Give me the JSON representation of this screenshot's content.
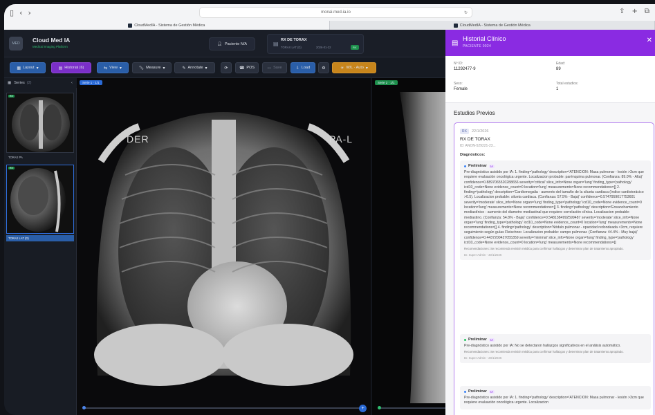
{
  "browser": {
    "url": "monai.med-ia.io",
    "tabs": [
      "CloudMedIA - Sistema de Gestión Médica",
      "CloudMedIA - Sistema de Gestión Médica"
    ]
  },
  "header": {
    "brand": "Cloud Med IA",
    "brand_sub": "Medical Imaging Platform",
    "patient_pill": "Paciente N/A",
    "study_title": "RX DE TORAX",
    "study_sub": "TORAX LAT (D)",
    "study_date": "2026-01-22",
    "study_badge": "RX"
  },
  "toolbar": {
    "layout": "Layout",
    "historial": "Historial (6)",
    "view": "View",
    "measure": "Measure",
    "annotate": "Annotate",
    "pos": "POS",
    "save": "Save",
    "load": "Load",
    "wl": "W/L · Auto"
  },
  "series": {
    "header": "Series",
    "count": "(2)",
    "items": [
      {
        "label": "TORAX PA",
        "badge": "RX"
      },
      {
        "label": "TORAX LAT (D)",
        "badge": "RX"
      }
    ]
  },
  "viewer": {
    "left_badge": "Serie 1 · 1/1",
    "right_badge": "Serie 2 · 1/1",
    "label_left": "DER",
    "label_right": "PA-L"
  },
  "panel": {
    "title": "Historial Clínico",
    "subtitle": "PACIENTE 0024",
    "id_label": "Nº ID:",
    "id_value": "11292477-9",
    "age_label": "Edad:",
    "age_value": "89",
    "sex_label": "Sexo:",
    "sex_value": "Female",
    "studies_label": "Total estudios:",
    "studies_value": "1",
    "previous_heading": "Estudios Previos",
    "card": {
      "badge": "RX",
      "date": "22/1/2026",
      "title": "RX DE TORAX",
      "id": "ID: ANON-529221-23...",
      "diag_label": "Diagnósticos:",
      "diagnoses": [
        {
          "status": "Preliminar",
          "tag": "IA",
          "text": "Pre-diagnóstico asistido por IA: 1. finding='pathology' description='ATENCION: Masa pulmonar - lesión >3cm que requiere evaluación oncológica urgente. Localizacion probable: parénquima pulmonar. (Confianza: 89.0% - Alta)' confidence=0.8897065520288656 severity='critical' slice_info=None organ='lung' finding_type='pathology' icd10_code=None evidence_count=0 location='lung' measurements=None recommendations=[] 2. finding='pathology' description='Cardiomegalia - aumento del tamaño de la silueta cardiaca (índice cardiotorácico >0.5). Localizacion probable: silueta cardiaca. (Confianza: 57.5% - Baja)' confidence=0.5747959017753601 severity='moderate' slice_info=None organ='lung' finding_type='pathology' icd10_code=None evidence_count=0 location='lung' measurements=None recommendations=[] 3. finding='pathology' description='Ensanchamiento mediastínico - aumento del diametro mediastinal que requiere correlación clínica. Localizacion probable: mediastino. (Confianza: 54.8% - Baja)' confidence=0.5481384992599487 severity='moderate' slice_info=None organ='lung' finding_type='pathology' icd10_code=None evidence_count=0 location='lung' measurements=None recommendations=[] 4. finding='pathology' description='Nódulo pulmonar - opacidad redondeada <3cm, requiere seguimiento según guías Fleischner. Localizacion probable: campo pulmonar. (Confianza: 44.4% - Muy baja)' confidence=0.4437200427055359 severity='minimal' slice_info=None organ='lung' finding_type='pathology' icd10_code=None evidence_count=0 location='lung' measurements=None recommendations=[]",
          "rec": "Recomendaciones: Se recomienda revisión médica para confirmar hallazgos y determinar plan de tratamiento apropiado.",
          "by": "Dr. Super Admin - 30/1/2026",
          "color": "#3b82f6"
        },
        {
          "status": "Preliminar",
          "tag": "IA",
          "text": "Pre-diagnóstico asistido por IA: No se detectaron hallazgos significativos en el análisis automático.",
          "rec": "Recomendaciones: Se recomienda revisión médica para confirmar hallazgos y determinar plan de tratamiento apropiado.",
          "by": "Dr. Super Admin - 28/1/2026",
          "color": "#22c55e"
        },
        {
          "status": "Preliminar",
          "tag": "IA",
          "text": "Pre-diagnóstico asistido por IA: 1. finding='pathology' description='ATENCION: Masa pulmonar - lesión >3cm que requiere evaluación oncológica urgente. Localizacion",
          "rec": "",
          "by": "",
          "color": "#3b82f6"
        }
      ]
    }
  }
}
